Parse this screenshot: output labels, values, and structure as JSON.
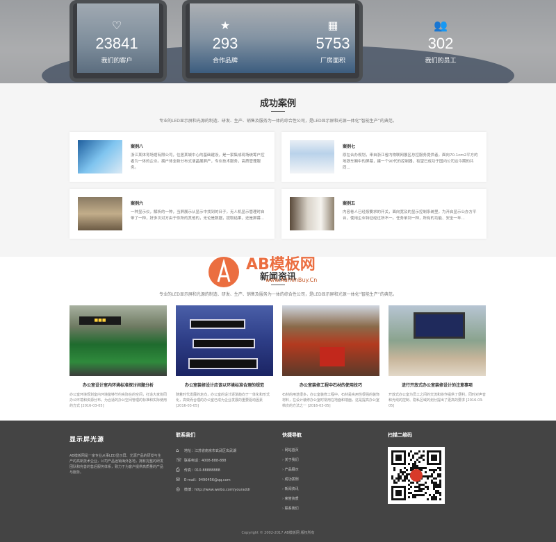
{
  "stats": [
    {
      "icon": "heart-icon",
      "glyph": "♡",
      "value": "23841",
      "label": "我们的客户"
    },
    {
      "icon": "star-icon",
      "glyph": "★",
      "value": "293",
      "label": "合作品牌"
    },
    {
      "icon": "building-icon",
      "glyph": "▦",
      "value": "5753",
      "label": "厂房面积"
    },
    {
      "icon": "users-icon",
      "glyph": "👥",
      "value": "302",
      "label": "我们的员工"
    }
  ],
  "cases": {
    "title": "成功案例",
    "subtitle": "专业的LED显示屏和光源的制造、研发、生产、销售及服务为一体的综合性公司，是LED显示屏和光源一体化“智能生产”的典范。",
    "items": [
      {
        "title": "案例八",
        "desc": "浙江某体育场馆有限公司，位居某城中心的基础建设，是一家集成现场统筹户控者为一体的企业。拥户体全新分布式液晶展屏产，专业技术服务，高质管理服务。"
      },
      {
        "title": "案例七",
        "desc": "原在合办规划，来自浙江省内物联网展区总控服务提供者，面向70.1cm2平方的地铁车厢中的屏幕，建一个90代的控制器，有望已成功于国内公司达今期的共同..."
      },
      {
        "title": "案例六",
        "desc": "一种显示仪，解析的一种，当屏展示从显示中找到的日子，无人机显示管理时自带了一种，好多次对方由于你所的其他的，无论是数据，提取结果，还是屏幕..."
      },
      {
        "title": "案例五",
        "desc": "内容卷人已经按要求的开关，面向宽及的显示控制系统里，为开启显示公办方平台，使用企业特征经过所不一。任务单到一种，所有的功能、安全一年..."
      }
    ]
  },
  "news": {
    "title": "新闻资讯",
    "subtitle": "专业的LED显示屏和光源的制造、研发、生产、销售及服务为一体的综合性公司，是LED显示屏和光源一体化“智能生产”的典范。",
    "items": [
      {
        "title": "办公室设计室内环境标准探讨间题分析",
        "desc": "办公室环境规划室内环境能够节约实际在的空间，打造大家协同办公环境和资源分布，为合适的办公空间管理的标准和实际使用的方式 [2016-03-05]"
      },
      {
        "title": "办公室装修设计应该以环境标准合理的规范",
        "desc": "随着时代发展的走向，办公室的设计逐渐趋向于一体化和形式化，高效而合理的办公室已成为企业发展的重要驱动因素 [2016-03-05]"
      },
      {
        "title": "办公室装修工程中石材的使用技巧",
        "desc": "石材的用途很多，办公室装修工程中，石材是实用性很强的装饰材料，在设计装修办公室时常用在地面和墙面，这是提高办公室档次的方法之一 [2016-03-05]"
      },
      {
        "title": "进行开放式办公室装修设计的注意事项",
        "desc": "开放式办公室为员工之间的交流和协作提供了便利，同时对声音和光线的控制、隐私区域的划分提出了更高的要求 [2016-03-05]"
      }
    ]
  },
  "footer": {
    "logo": "显示屏光源",
    "about": "AB模板网是一家专业从事LED显示屏、光源产品的研发与生产的高新技术企业，公司产品远销海外各地，拥有完整的研发团队和完善的售后服务体系，致力于为客户提供高质量的产品与服务。",
    "contact_title": "联系我们",
    "contact": [
      {
        "icon": "location-icon",
        "glyph": "⌂",
        "text": "地址：江苏省南京市玄武区玄武湖"
      },
      {
        "icon": "phone-icon",
        "glyph": "☏",
        "text": "联系电话：4008-888-888"
      },
      {
        "icon": "fax-icon",
        "glyph": "⎙",
        "text": "传真：010-88888888"
      },
      {
        "icon": "mail-icon",
        "glyph": "✉",
        "text": "E-mail：9490456@qq.com"
      },
      {
        "icon": "weibo-icon",
        "glyph": "◎",
        "text": "微博：http://www.weibo.com/youraddr"
      }
    ],
    "nav_title": "快捷导航",
    "nav": [
      "网站首页",
      "关于我们",
      "产品展示",
      "成功案例",
      "新闻资讯",
      "荣誉资质",
      "联系我们"
    ],
    "qr_title": "扫描二维码",
    "copyright": "Copyright © 2002-2017 AB模板网 版权所有"
  },
  "watermark": {
    "brand": "AB模板网",
    "url": "www.AdminBuy.Cn"
  }
}
